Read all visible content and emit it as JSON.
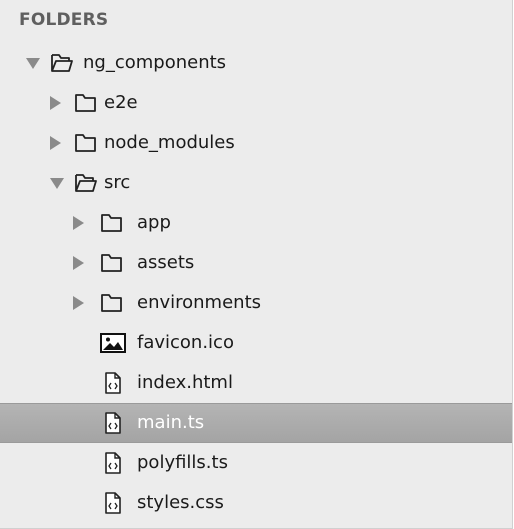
{
  "sidebar": {
    "header": "FOLDERS",
    "items": [
      {
        "label": "ng_components",
        "icon": "folder-open-icon",
        "arrow": "expanded"
      },
      {
        "label": "e2e",
        "icon": "folder-icon",
        "arrow": "collapsed"
      },
      {
        "label": "node_modules",
        "icon": "folder-icon",
        "arrow": "collapsed"
      },
      {
        "label": "src",
        "icon": "folder-open-icon",
        "arrow": "expanded"
      },
      {
        "label": "app",
        "icon": "folder-icon",
        "arrow": "collapsed"
      },
      {
        "label": "assets",
        "icon": "folder-icon",
        "arrow": "collapsed"
      },
      {
        "label": "environments",
        "icon": "folder-icon",
        "arrow": "collapsed"
      },
      {
        "label": "favicon.ico",
        "icon": "image-file-icon",
        "arrow": "none"
      },
      {
        "label": "index.html",
        "icon": "code-file-icon",
        "arrow": "none"
      },
      {
        "label": "main.ts",
        "icon": "code-file-icon",
        "arrow": "none",
        "selected": true
      },
      {
        "label": "polyfills.ts",
        "icon": "code-file-icon",
        "arrow": "none"
      },
      {
        "label": "styles.css",
        "icon": "code-file-icon",
        "arrow": "none"
      }
    ]
  }
}
